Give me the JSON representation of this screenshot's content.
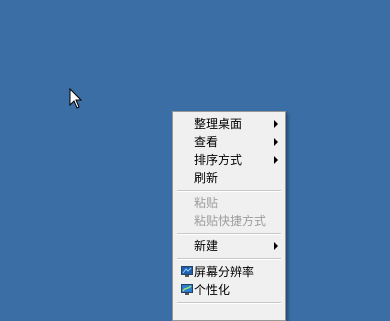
{
  "context_menu": {
    "items": [
      {
        "label": "整理桌面"
      },
      {
        "label": "查看"
      },
      {
        "label": "排序方式"
      },
      {
        "label": "刷新"
      },
      {
        "label": "粘贴"
      },
      {
        "label": "粘贴快捷方式"
      },
      {
        "label": "新建"
      },
      {
        "label": "屏幕分辨率",
        "icon": "display-icon"
      },
      {
        "label": "个性化",
        "icon": "personalize-icon"
      }
    ]
  },
  "colors": {
    "desktop_background": "#3a6ea5",
    "menu_background": "#f0f0f0",
    "disabled_text": "#9d9d9d"
  }
}
